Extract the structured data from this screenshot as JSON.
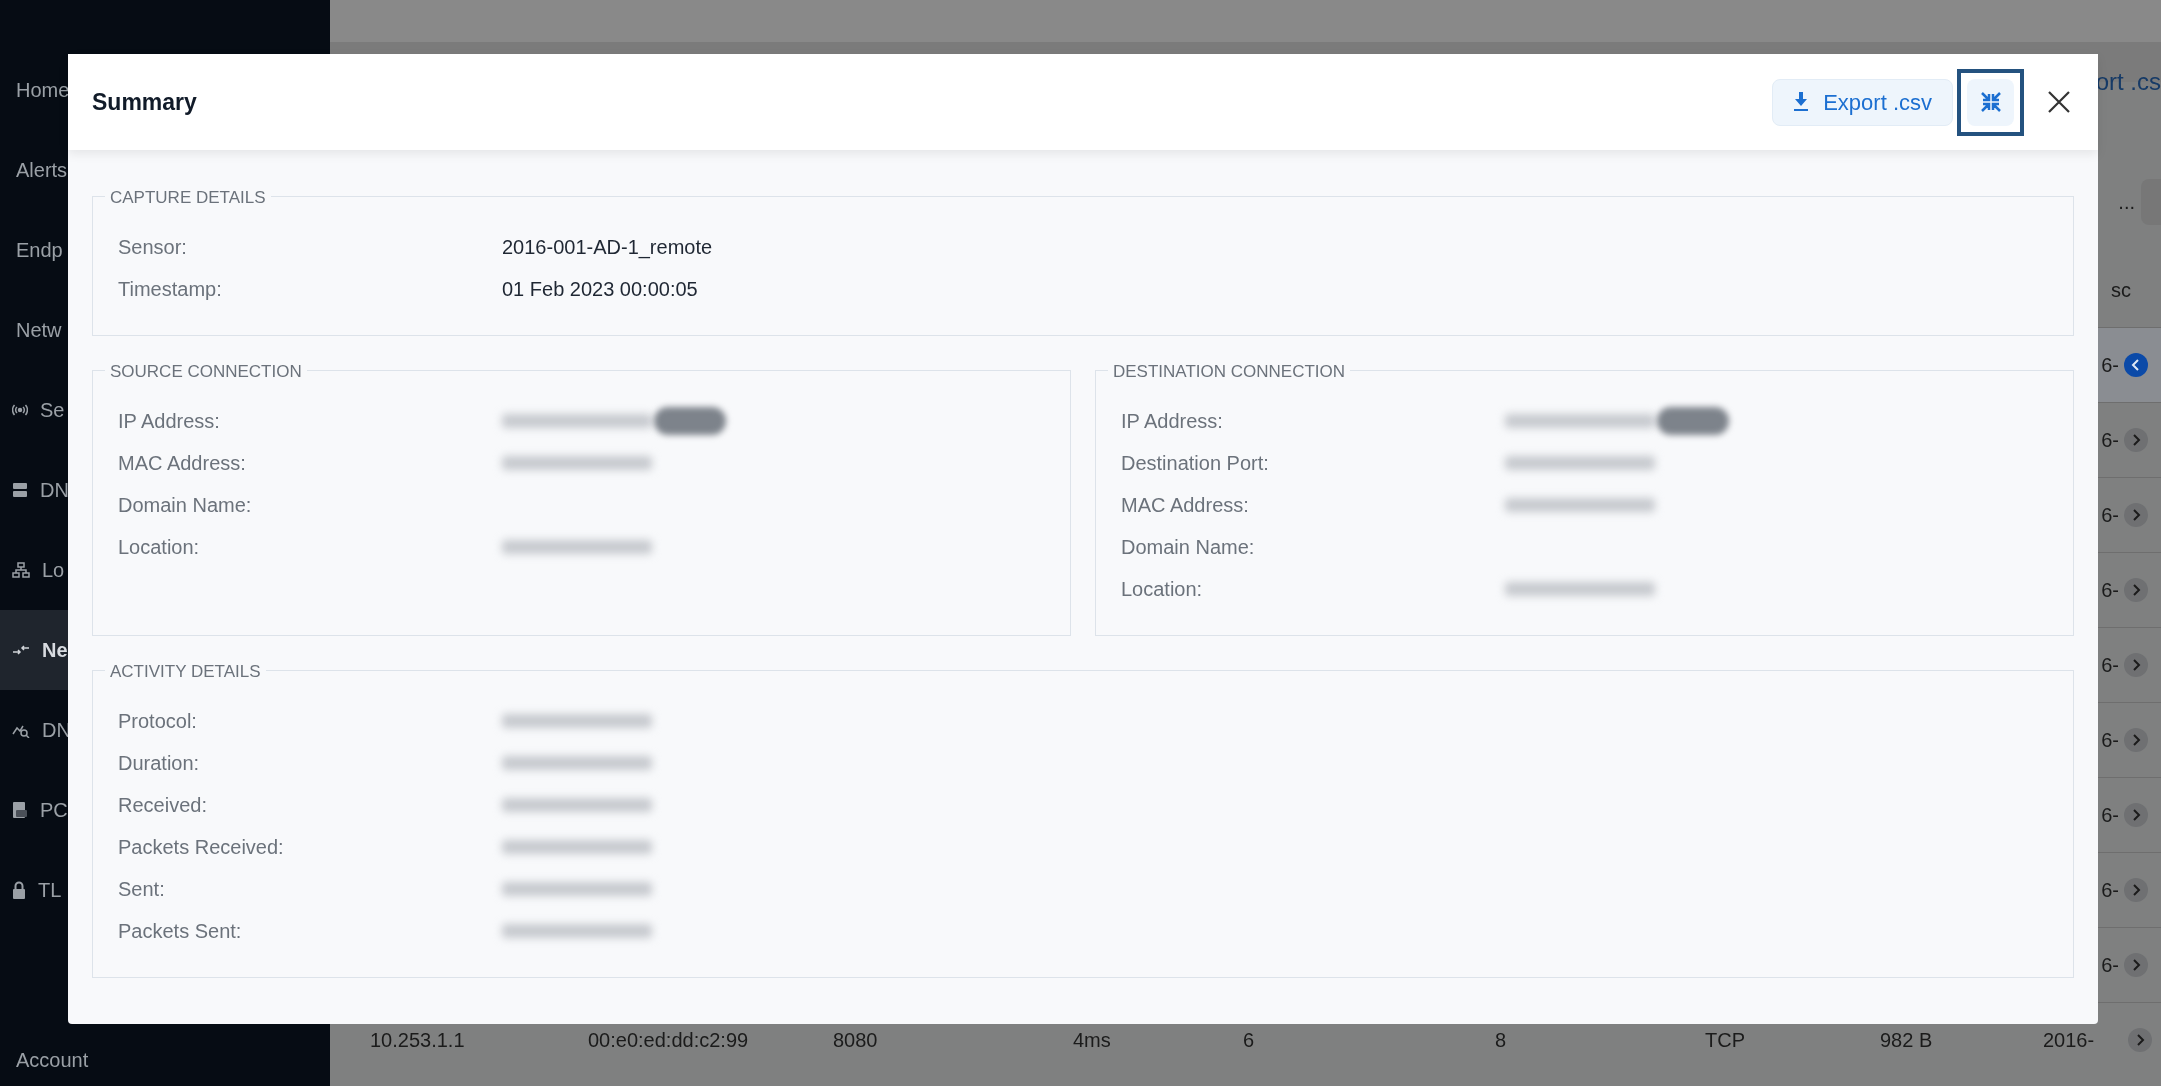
{
  "sidebar": {
    "items": [
      {
        "label": "Home",
        "selected": false
      },
      {
        "label": "Alerts",
        "selected": false
      },
      {
        "label": "Endp",
        "selected": false
      },
      {
        "label": "Netw",
        "selected": false
      },
      {
        "label": "Se",
        "selected": false
      },
      {
        "label": "DN",
        "selected": false
      },
      {
        "label": "Lo",
        "selected": false
      },
      {
        "label": "Ne",
        "selected": true
      },
      {
        "label": "DN",
        "selected": false
      },
      {
        "label": "PC",
        "selected": false
      },
      {
        "label": "TL",
        "selected": false
      }
    ],
    "account": "Account"
  },
  "background": {
    "export_label": "ort .cs",
    "more": "...",
    "column_header": "sc",
    "rows": [
      {
        "cell": "6-",
        "selected": true
      },
      {
        "cell": "6-",
        "selected": false
      },
      {
        "cell": "6-",
        "selected": false
      },
      {
        "cell": "6-",
        "selected": false
      },
      {
        "cell": "6-",
        "selected": false
      },
      {
        "cell": "6-",
        "selected": false
      },
      {
        "cell": "6-",
        "selected": false
      },
      {
        "cell": "6-",
        "selected": false
      },
      {
        "cell": "6-",
        "selected": false
      }
    ],
    "last_row": {
      "cells": [
        "10.253.1.1",
        "00:e0:ed:dd:c2:99",
        "8080",
        "4ms",
        "6",
        "8",
        "TCP",
        "982 B",
        "2016-"
      ],
      "selected": false
    }
  },
  "modal": {
    "title": "Summary",
    "export_button": "Export .csv",
    "minimize_focused": true,
    "sections": [
      {
        "legend": "CAPTURE DETAILS",
        "fields": [
          {
            "label": "Sensor:",
            "value": "2016-001-AD-1_remote",
            "redacted": false
          },
          {
            "label": "Timestamp:",
            "value": "01 Feb 2023 00:00:05",
            "redacted": false
          }
        ]
      },
      {
        "legend": "SOURCE CONNECTION",
        "fields": [
          {
            "label": "IP Address:",
            "redacted": true,
            "pill": true
          },
          {
            "label": "MAC Address:",
            "redacted": true
          },
          {
            "label": "Domain Name:",
            "redacted": false
          },
          {
            "label": "Location:",
            "redacted": true
          }
        ]
      },
      {
        "legend": "DESTINATION CONNECTION",
        "fields": [
          {
            "label": "IP Address:",
            "redacted": true,
            "pill": true
          },
          {
            "label": "Destination Port:",
            "redacted": true
          },
          {
            "label": "MAC Address:",
            "redacted": true
          },
          {
            "label": "Domain Name:",
            "redacted": false
          },
          {
            "label": "Location:",
            "redacted": true
          }
        ]
      },
      {
        "legend": "ACTIVITY DETAILS",
        "fields": [
          {
            "label": "Protocol:",
            "redacted": true
          },
          {
            "label": "Duration:",
            "redacted": true
          },
          {
            "label": "Received:",
            "redacted": true
          },
          {
            "label": "Packets Received:",
            "redacted": true
          },
          {
            "label": "Sent:",
            "redacted": true
          },
          {
            "label": "Packets Sent:",
            "redacted": true
          }
        ]
      }
    ]
  }
}
